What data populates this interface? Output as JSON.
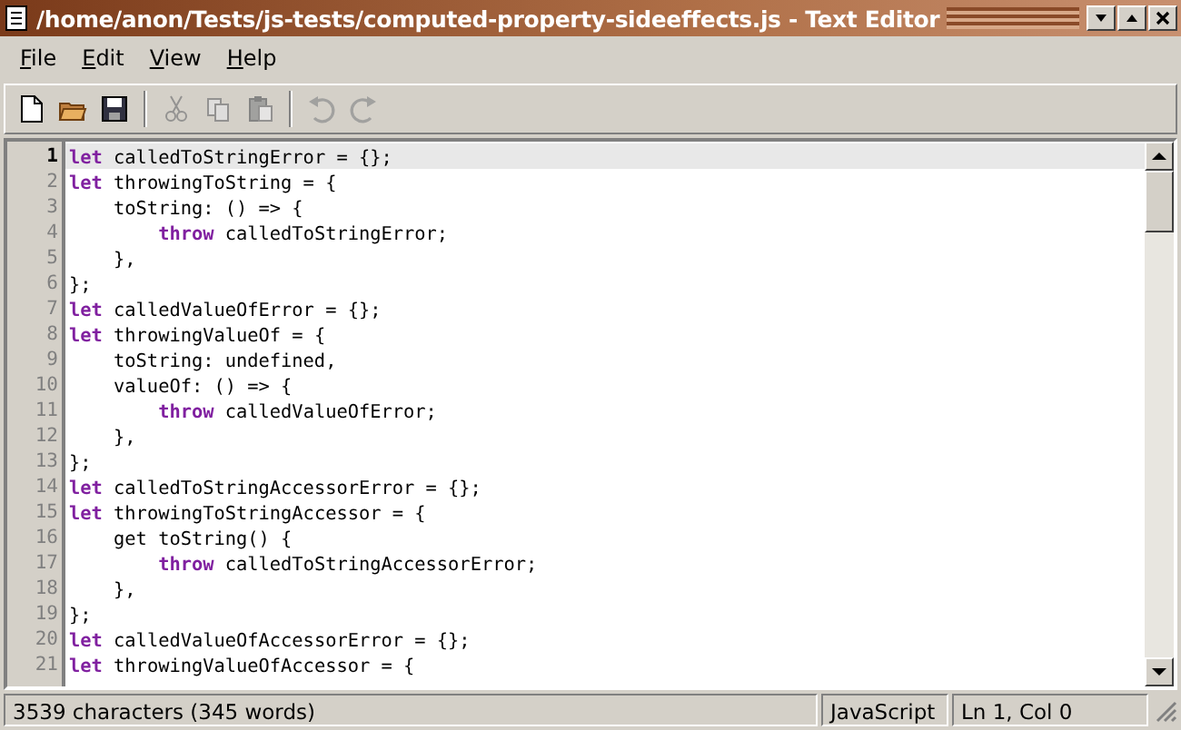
{
  "window": {
    "title": "/home/anon/Tests/js-tests/computed-property-sideeffects.js - Text Editor"
  },
  "menu": [
    {
      "label": "File"
    },
    {
      "label": "Edit"
    },
    {
      "label": "View"
    },
    {
      "label": "Help"
    }
  ],
  "toolbar": [
    {
      "kind": "new",
      "disabled": false
    },
    {
      "kind": "open",
      "disabled": false
    },
    {
      "kind": "save",
      "disabled": false
    },
    {
      "kind": "separator"
    },
    {
      "kind": "cut",
      "disabled": true
    },
    {
      "kind": "copy",
      "disabled": true
    },
    {
      "kind": "paste",
      "disabled": true
    },
    {
      "kind": "separator"
    },
    {
      "kind": "undo",
      "disabled": true
    },
    {
      "kind": "redo",
      "disabled": true
    }
  ],
  "editor": {
    "lines": [
      {
        "number": "1",
        "current": true,
        "text": "**let** calledToStringError = {};"
      },
      {
        "number": "2",
        "current": false,
        "text": "**let** throwingToString = {"
      },
      {
        "number": "3",
        "current": false,
        "text": "    toString: () => {"
      },
      {
        "number": "4",
        "current": false,
        "text": "        **throw** calledToStringError;"
      },
      {
        "number": "5",
        "current": false,
        "text": "    },"
      },
      {
        "number": "6",
        "current": false,
        "text": "};"
      },
      {
        "number": "7",
        "current": false,
        "text": "**let** calledValueOfError = {};"
      },
      {
        "number": "8",
        "current": false,
        "text": "**let** throwingValueOf = {"
      },
      {
        "number": "9",
        "current": false,
        "text": "    toString: undefined,"
      },
      {
        "number": "10",
        "current": false,
        "text": "    valueOf: () => {"
      },
      {
        "number": "11",
        "current": false,
        "text": "        **throw** calledValueOfError;"
      },
      {
        "number": "12",
        "current": false,
        "text": "    },"
      },
      {
        "number": "13",
        "current": false,
        "text": "};"
      },
      {
        "number": "14",
        "current": false,
        "text": "**let** calledToStringAccessorError = {};"
      },
      {
        "number": "15",
        "current": false,
        "text": "**let** throwingToStringAccessor = {"
      },
      {
        "number": "16",
        "current": false,
        "text": "    get toString() {"
      },
      {
        "number": "17",
        "current": false,
        "text": "        **throw** calledToStringAccessorError;"
      },
      {
        "number": "18",
        "current": false,
        "text": "    },"
      },
      {
        "number": "19",
        "current": false,
        "text": "};"
      },
      {
        "number": "20",
        "current": false,
        "text": "**let** calledValueOfAccessorError = {};"
      },
      {
        "number": "21",
        "current": false,
        "text": "**let** throwingValueOfAccessor = {"
      }
    ]
  },
  "status_bar": {
    "message": "3539 characters (345 words)",
    "language": "JavaScript",
    "position": "Ln 1, Col 0"
  }
}
